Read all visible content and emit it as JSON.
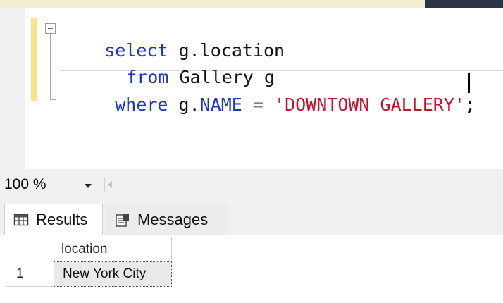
{
  "editor": {
    "line1": {
      "keyword": "select",
      "text": " g.location"
    },
    "line2": {
      "keyword": "from",
      "text": " Gallery g"
    },
    "line3": {
      "keyword": "where",
      "text_before": " g.",
      "column": "NAME",
      "operator": " = ",
      "string": "'DOWNTOWN GALLERY'",
      "terminator": ";"
    }
  },
  "status": {
    "zoom": "100 %"
  },
  "tabs": [
    {
      "label": "Results",
      "icon": "grid-icon"
    },
    {
      "label": "Messages",
      "icon": "messages-icon"
    }
  ],
  "results": {
    "columns": [
      "location"
    ],
    "rows": [
      {
        "number": "1",
        "values": [
          "New York City"
        ]
      }
    ]
  },
  "colors": {
    "keyword": "#1a35c8",
    "string": "#c8102e",
    "operator": "#808080",
    "change_marker": "#f6e58d"
  }
}
